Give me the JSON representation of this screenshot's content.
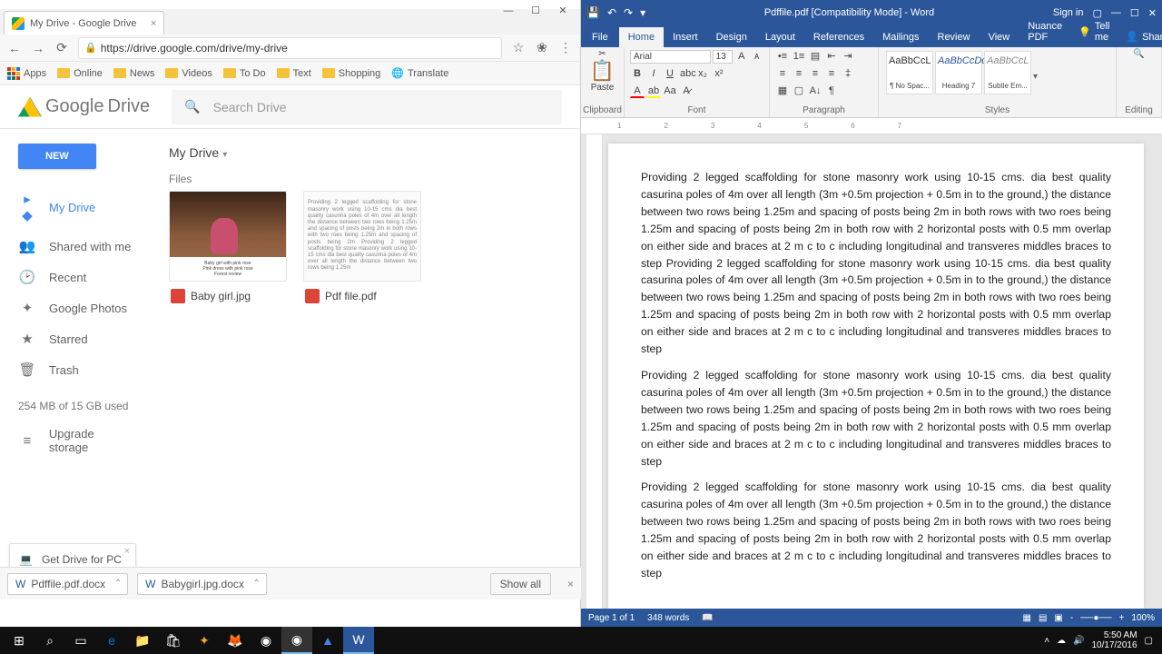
{
  "chrome": {
    "tab_title": "My Drive - Google Drive",
    "url": "https://drive.google.com/drive/my-drive",
    "bookmarks": {
      "apps": "Apps",
      "items": [
        "Online",
        "News",
        "Videos",
        "To Do",
        "Text",
        "Shopping"
      ],
      "translate": "Translate"
    }
  },
  "drive": {
    "logo_a": "Google",
    "logo_b": "Drive",
    "search_placeholder": "Search Drive",
    "new_btn": "NEW",
    "side": {
      "mydrive": "My Drive",
      "shared": "Shared with me",
      "recent": "Recent",
      "photos": "Google Photos",
      "starred": "Starred",
      "trash": "Trash",
      "quota": "254 MB of 15 GB used",
      "upgrade": "Upgrade storage"
    },
    "crumb": "My Drive",
    "files_label": "Files",
    "file1": {
      "name": "Baby girl.jpg",
      "cap1": "Baby girl with pink rose",
      "cap2": "Pink dress with pink rose",
      "cap3": "Forest review"
    },
    "file2": {
      "name": "Pdf file.pdf"
    },
    "promo": "Get Drive for PC",
    "downloads": {
      "f1": "Pdffile.pdf.docx",
      "f2": "Babygirl.jpg.docx",
      "showall": "Show all"
    }
  },
  "word": {
    "title": "Pdffile.pdf [Compatibility Mode] - Word",
    "signin": "Sign in",
    "tabs": {
      "file": "File",
      "home": "Home",
      "insert": "Insert",
      "design": "Design",
      "layout": "Layout",
      "references": "References",
      "mailings": "Mailings",
      "review": "Review",
      "view": "View",
      "nuance": "Nuance PDF",
      "tell": "Tell me",
      "share": "Share"
    },
    "ribbon": {
      "paste": "Paste",
      "clipboard": "Clipboard",
      "font_name": "Arial",
      "font_size": "13",
      "font": "Font",
      "paragraph": "Paragraph",
      "style1": "AaBbCcL",
      "style1n": "¶ No Spac...",
      "style2": "AaBbCcDc",
      "style2n": "Heading 7",
      "style3": "AaBbCcL",
      "style3n": "Subtle Em...",
      "styles": "Styles",
      "editing": "Editing"
    },
    "body_para": "Providing 2 legged scaffolding for stone masonry work using 10-15 cms. dia best quality casurina poles of 4m over all length (3m +0.5m projection + 0.5m in to the ground,) the distance between two rows being 1.25m and spacing of posts being 2m in both rows with two roes being 1.25m and spacing of posts being 2m in both row with 2 horizontal posts with 0.5 mm overlap on either side and braces at 2 m c to c including longitudinal and transveres middles braces to step Providing 2 legged scaffolding for stone masonry work using 10-15 cms. dia best quality casurina poles of 4m over all length (3m +0.5m projection + 0.5m in to the ground,) the distance between two rows being 1.25m and spacing of posts being 2m in both rows with two roes being 1.25m and spacing of posts being 2m in both row with 2 horizontal posts with 0.5 mm overlap on either side and braces at 2 m c to c including longitudinal and transveres middles braces to step",
    "body_para2": "Providing 2 legged scaffolding for stone masonry work using 10-15 cms. dia best quality casurina poles of 4m over all length (3m +0.5m projection + 0.5m in to the ground,) the distance between two rows being 1.25m and spacing of posts being 2m in both rows with two roes being 1.25m and spacing of posts being 2m in both row with 2 horizontal posts with 0.5 mm overlap on either side and braces at 2 m c to c including longitudinal and transveres middles braces to step",
    "status": {
      "page": "Page 1 of 1",
      "words": "348 words",
      "zoom": "100%"
    }
  },
  "taskbar": {
    "time": "5:50 AM",
    "date": "10/17/2016"
  }
}
